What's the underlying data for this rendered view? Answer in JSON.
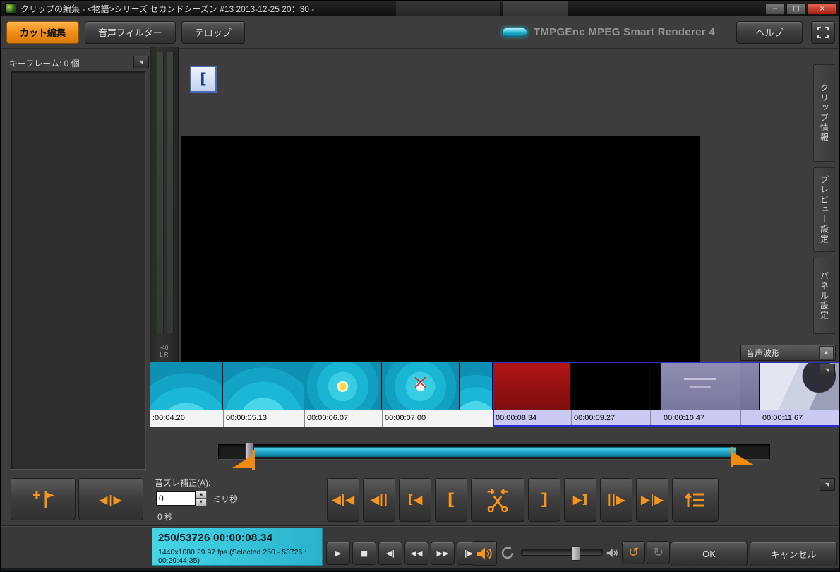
{
  "window": {
    "title": "クリップの編集 - <物語>シリーズ セカンドシーズン #13 2013-12-25 20：30 -",
    "minimize": "−",
    "maximize": "□",
    "close": "×"
  },
  "toolbar": {
    "tab_cut": "カット編集",
    "tab_audio_filter": "音声フィルター",
    "tab_telop": "テロップ",
    "brand": "TMPGEnc MPEG Smart Renderer 4",
    "help": "ヘルプ"
  },
  "keyframe_panel": {
    "header": "キーフレーム: 0 個",
    "nav_glyph": "◀|▶"
  },
  "side_tabs": {
    "clip_info": "クリップ情報",
    "preview_settings": "プレビュー設定",
    "panel_settings": "パネル設定"
  },
  "waveform_label": "音声波形",
  "meter": {
    "bottom_scale": "-40",
    "channels": "L R"
  },
  "timeline": {
    "timestamps": [
      ":00:04.20",
      "00:00:05.13",
      "00:00:06.07",
      "00:00:07.00",
      "",
      "00:00:08.34",
      "00:00:09.27",
      "",
      "00:00:10.47",
      "",
      "00:00:11.67"
    ]
  },
  "audio_sync": {
    "label": "音ズレ補正(A):",
    "value": "0",
    "unit": "ミリ秒",
    "total": "0 秒"
  },
  "edit_buttons": {
    "prev_cut": "◀|◀",
    "back_frame": "◀||",
    "jump_in": "[◀",
    "set_in": "[",
    "set_out": "]",
    "jump_out": "▶]",
    "fwd_frame": "||▶",
    "next_cut": "▶|▶"
  },
  "transport": {
    "play": "▶",
    "stop": "■",
    "frame_back": "◀|",
    "rewind": "◀◀",
    "forward": "▶▶",
    "frame_fwd": "|▶"
  },
  "history": {
    "undo": "↺",
    "redo": "↻"
  },
  "status": {
    "position": "250/53726 00:00:08.34",
    "details": "1440x1080 29.97 fps (Selected 250 - 53726 : 00:29:44.35)"
  },
  "actions": {
    "ok": "OK",
    "cancel": "キャンセル"
  },
  "collapse_glyph": "◥"
}
